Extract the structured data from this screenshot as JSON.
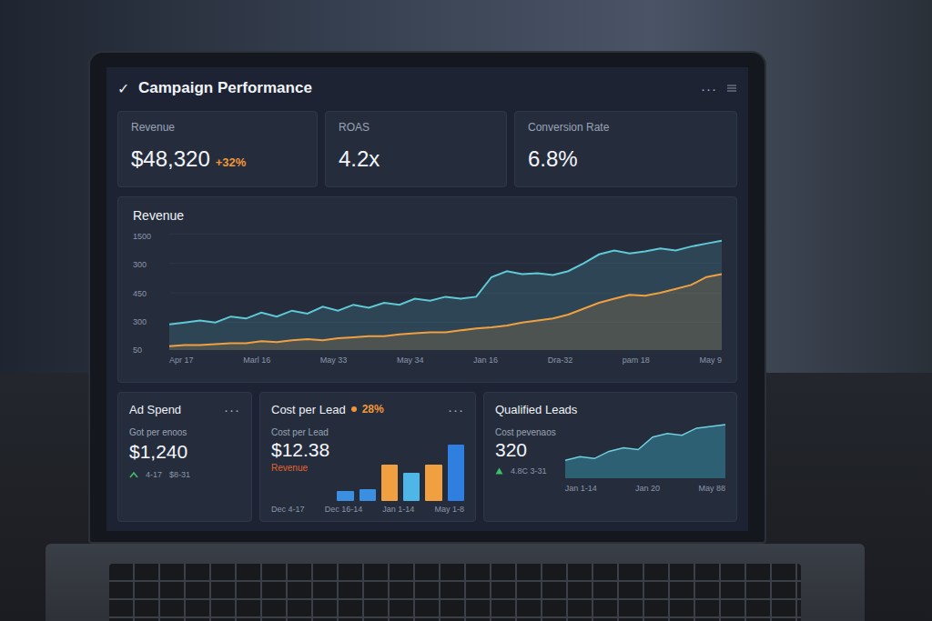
{
  "header": {
    "check_icon": "✓",
    "title": "Campaign Performance",
    "menu": "···"
  },
  "kpis": [
    {
      "label": "Revenue",
      "value": "$48,320",
      "delta": "+32%"
    },
    {
      "label": "ROAS",
      "value": "4.2x",
      "delta": ""
    },
    {
      "label": "Conversion Rate",
      "value": "6.8%",
      "delta": ""
    }
  ],
  "revenue_chart": {
    "title": "Revenue",
    "y_ticks": [
      "1500",
      "300",
      "450",
      "300",
      "50"
    ],
    "x_ticks": [
      "Apr 17",
      "Marl 16",
      "May 33",
      "May 34",
      "Jan 16",
      "Dra-32",
      "pam 18",
      "May 9"
    ],
    "series": [
      {
        "color": "#5fc9d6",
        "values": [
          26,
          28,
          30,
          28,
          34,
          32,
          38,
          34,
          40,
          37,
          44,
          40,
          46,
          43,
          48,
          46,
          52,
          50,
          54,
          52,
          54,
          74,
          80,
          77,
          78,
          76,
          80,
          88,
          97,
          101,
          98,
          100,
          103,
          101,
          105,
          108,
          111
        ]
      },
      {
        "color": "#f0a040",
        "values": [
          4,
          5,
          5,
          6,
          7,
          7,
          9,
          8,
          10,
          11,
          10,
          12,
          13,
          14,
          14,
          16,
          17,
          18,
          18,
          20,
          22,
          23,
          25,
          28,
          30,
          32,
          36,
          42,
          48,
          52,
          56,
          55,
          58,
          62,
          66,
          74,
          77
        ]
      }
    ]
  },
  "ad_spend": {
    "title": "Ad Spend",
    "menu": "···",
    "label": "Got per enoos",
    "value": "$1,240",
    "trend_from": "4-17",
    "trend_to": "$8-31"
  },
  "cost_per_lead": {
    "title": "Cost per Lead",
    "delta": "28%",
    "menu": "···",
    "label": "Cost per Lead",
    "value": "$12.38",
    "sublabel": "Revenue",
    "bars": [
      {
        "value": 10,
        "color": "#3a8fe0"
      },
      {
        "value": 12,
        "color": "#3a8fe0"
      },
      {
        "value": 36,
        "color": "#f0a040"
      },
      {
        "value": 28,
        "color": "#4fb6e8"
      },
      {
        "value": 36,
        "color": "#f0a040"
      },
      {
        "value": 56,
        "color": "#2f7fe0"
      }
    ],
    "x_ticks": [
      "Dec 4-17",
      "Dec 16-14",
      "Jan 1-14",
      "May 1-8"
    ]
  },
  "qualified_leads": {
    "title": "Qualified Leads",
    "label": "Cost pevenaos",
    "value": "320",
    "trend": "4.8C 3-31",
    "values": [
      20,
      24,
      22,
      30,
      34,
      32,
      46,
      50,
      48,
      56,
      58,
      60
    ],
    "x_ticks": [
      "Jan 1-14",
      "Jan 20",
      "May 88"
    ]
  }
}
